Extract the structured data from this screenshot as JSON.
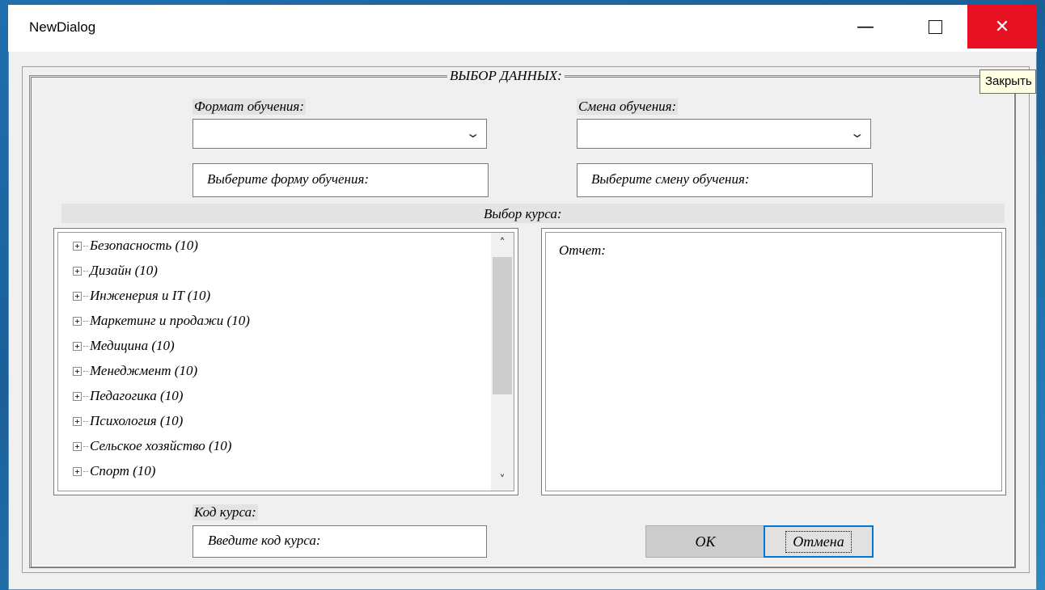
{
  "window": {
    "title": "NewDialog",
    "minimize_glyph": "—",
    "close_glyph": "✕",
    "close_tooltip": "Закрыть"
  },
  "colors": {
    "close_button": "#e81123",
    "focus_border": "#0078d7",
    "background": "#1f6fae"
  },
  "group": {
    "title": "ВЫБОР ДАННЫХ:"
  },
  "format": {
    "label": "Формат обучения:",
    "selected": "",
    "textbox": "Выберите форму обучения:"
  },
  "shift": {
    "label": "Смена обучения:",
    "selected": "",
    "textbox": "Выберите смену обучения:"
  },
  "course_section": {
    "label": "Выбор курса:"
  },
  "tree": {
    "items": [
      {
        "label": "Безопасность (10)"
      },
      {
        "label": "Дизайн (10)"
      },
      {
        "label": "Инженерия и IT (10)"
      },
      {
        "label": "Маркетинг и продажи (10)"
      },
      {
        "label": "Медицина (10)"
      },
      {
        "label": "Менеджмент (10)"
      },
      {
        "label": "Педагогика (10)"
      },
      {
        "label": "Психология (10)"
      },
      {
        "label": "Сельское хозяйство (10)"
      },
      {
        "label": "Спорт (10)"
      }
    ]
  },
  "report": {
    "text": "Отчет:"
  },
  "course_code": {
    "label": "Код курса:",
    "value": "Введите код курса:"
  },
  "buttons": {
    "ok": "OK",
    "cancel": "Отмена"
  }
}
